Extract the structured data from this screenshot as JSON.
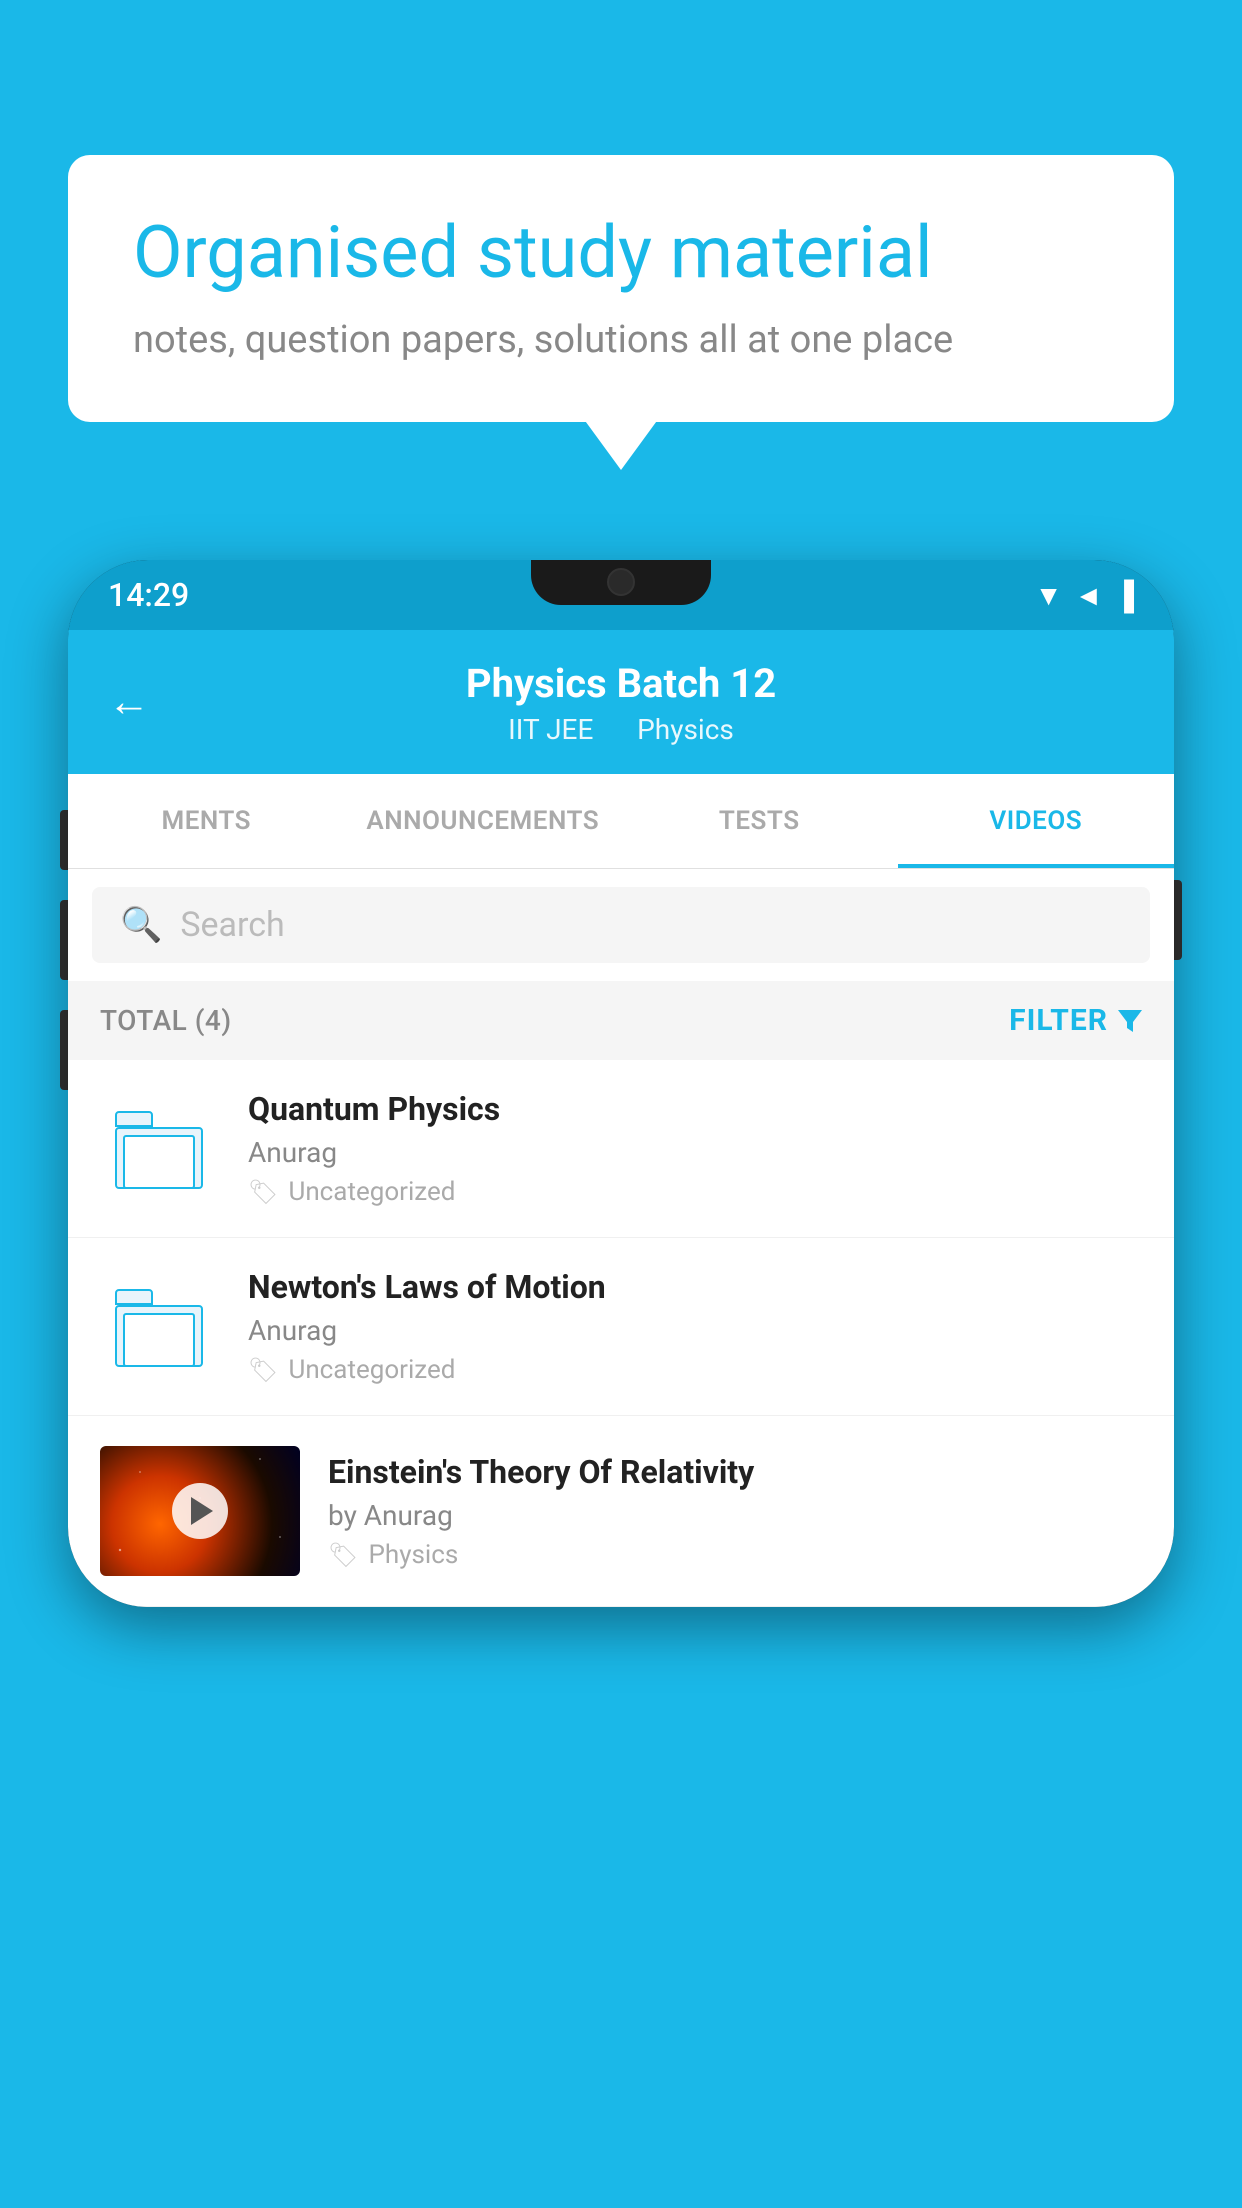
{
  "background_color": "#1ab8e8",
  "speech_bubble": {
    "headline": "Organised study material",
    "subtext": "notes, question papers, solutions all at one place"
  },
  "phone": {
    "status_bar": {
      "time": "14:29",
      "icons": "▼◄▐"
    },
    "header": {
      "title": "Physics Batch 12",
      "subtitle_left": "IIT JEE",
      "subtitle_right": "Physics",
      "back_label": "←"
    },
    "tabs": [
      {
        "label": "MENTS",
        "active": false
      },
      {
        "label": "ANNOUNCEMENTS",
        "active": false
      },
      {
        "label": "TESTS",
        "active": false
      },
      {
        "label": "VIDEOS",
        "active": true
      }
    ],
    "search": {
      "placeholder": "Search"
    },
    "filter_bar": {
      "total_label": "TOTAL (4)",
      "filter_label": "FILTER"
    },
    "video_list": [
      {
        "title": "Quantum Physics",
        "author": "Anurag",
        "tag": "Uncategorized",
        "has_thumb": false
      },
      {
        "title": "Newton's Laws of Motion",
        "author": "Anurag",
        "tag": "Uncategorized",
        "has_thumb": false
      },
      {
        "title": "Einstein's Theory Of Relativity",
        "author": "by Anurag",
        "tag": "Physics",
        "has_thumb": true
      }
    ]
  }
}
